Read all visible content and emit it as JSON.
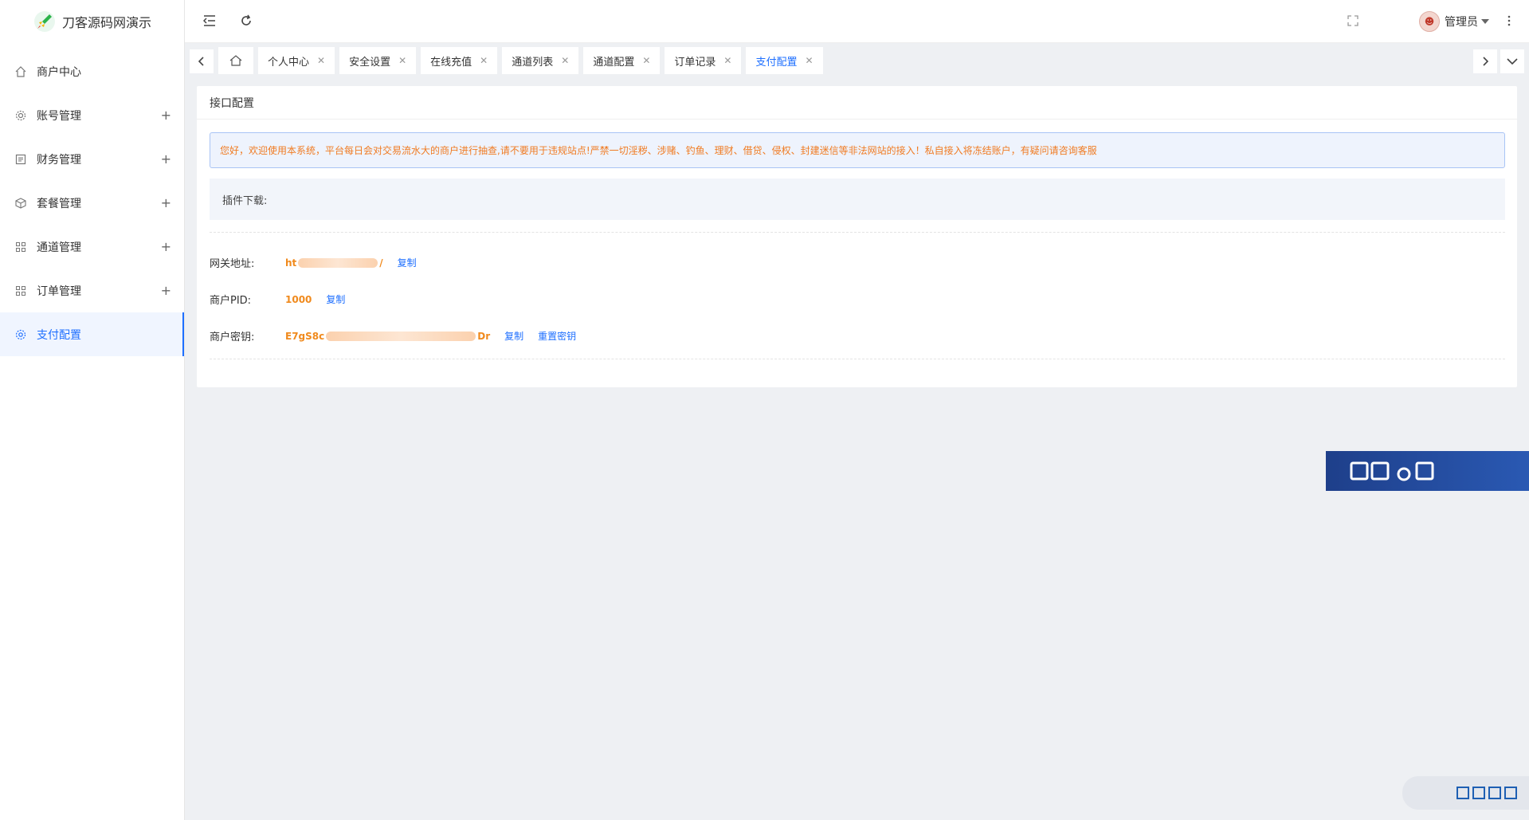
{
  "app": {
    "title": "刀客源码网演示"
  },
  "sidebar": {
    "items": [
      {
        "label": "商户中心",
        "icon": "home-icon",
        "expandable": false,
        "active": false
      },
      {
        "label": "账号管理",
        "icon": "gear-icon",
        "expandable": true,
        "active": false
      },
      {
        "label": "财务管理",
        "icon": "finance-icon",
        "expandable": true,
        "active": false
      },
      {
        "label": "套餐管理",
        "icon": "package-icon",
        "expandable": true,
        "active": false
      },
      {
        "label": "通道管理",
        "icon": "apps-icon",
        "expandable": true,
        "active": false
      },
      {
        "label": "订单管理",
        "icon": "apps-icon",
        "expandable": true,
        "active": false
      },
      {
        "label": "支付配置",
        "icon": "settings-icon",
        "expandable": false,
        "active": true
      }
    ],
    "plus": "+"
  },
  "header": {
    "user_name": "管理员"
  },
  "tabs": [
    {
      "label": "个人中心"
    },
    {
      "label": "安全设置"
    },
    {
      "label": "在线充值"
    },
    {
      "label": "通道列表"
    },
    {
      "label": "通道配置"
    },
    {
      "label": "订单记录"
    },
    {
      "label": "支付配置",
      "active": true
    }
  ],
  "tab_close": "✕",
  "card": {
    "title": "接口配置",
    "notice": "您好，欢迎使用本系统，平台每日会对交易流水大的商户进行抽查,请不要用于违规站点!严禁一切淫秽、涉赌、钓鱼、理财、借贷、侵权、封建迷信等非法网站的接入！私自接入将冻结账户，有疑问请咨询客服",
    "plugin_label": "插件下载:",
    "gateway": {
      "label": "网关地址:",
      "value_start": "ht",
      "value_end": "/",
      "copy": "复制"
    },
    "pid": {
      "label": "商户PID:",
      "value": "1000",
      "copy": "复制"
    },
    "secret": {
      "label": "商户密钥:",
      "value_start": "E7gS8c",
      "value_end": "Dr",
      "copy": "复制",
      "reset": "重置密钥"
    }
  },
  "colors": {
    "accent": "#1e6fff",
    "warning": "#f07b22"
  }
}
